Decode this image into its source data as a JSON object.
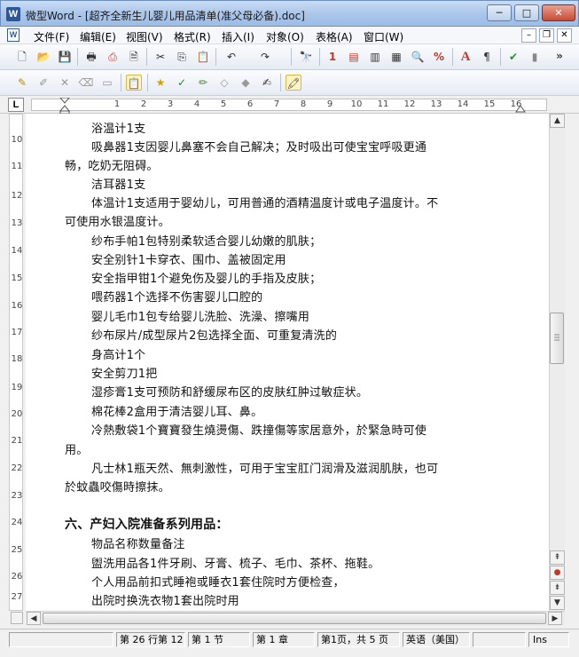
{
  "window": {
    "app_name": "微型Word",
    "title": "- [超齐全新生儿婴儿用品清单(准父母必备).doc]",
    "minimize": "─",
    "maximize": "□",
    "close": "✕"
  },
  "menu": {
    "items": [
      "文件(F)",
      "编辑(E)",
      "视图(V)",
      "格式(R)",
      "插入(I)",
      "对象(O)",
      "表格(A)",
      "窗口(W)"
    ],
    "mdi_minimize": "–",
    "mdi_restore": "❐",
    "mdi_close": "✕"
  },
  "toolbar1": {
    "icons": [
      "new-icon",
      "open-icon",
      "save-icon",
      "print-icon",
      "pdf-icon",
      "print-preview-icon",
      "cut-icon",
      "copy-icon",
      "paste-icon",
      "undo-icon",
      "redo-icon",
      "find-icon",
      "page-number-icon",
      "header-icon",
      "footer-icon",
      "columns-icon",
      "zoom-icon",
      "percent-icon",
      "font-icon",
      "paragraph-icon",
      "spellcheck-icon",
      "word-count-icon"
    ],
    "glyphs": [
      "🗋",
      "📂",
      "💾",
      "🖶",
      "⎙",
      "🗎",
      "✂",
      "⎘",
      "📋",
      "↶",
      "↷",
      "🔭",
      "1",
      "▤",
      "▥",
      "▦",
      "🔍",
      "%",
      "A",
      "¶",
      "✔",
      "▮"
    ],
    "overflow": "»"
  },
  "toolbar2": {
    "icons": [
      "highlight-icon",
      "edit-icon",
      "delete-icon",
      "clear-icon",
      "erase-icon",
      "clipboard-icon",
      "star-icon",
      "check-icon",
      "pencil-icon",
      "eraser-icon",
      "eraser2-icon",
      "note-icon",
      "highlighter-icon"
    ],
    "glyphs": [
      "✎",
      "✐",
      "✕",
      "⌫",
      "▭",
      "📋",
      "★",
      "✓",
      "✏",
      "◇",
      "◆",
      "✍",
      "🖍"
    ]
  },
  "ruler": {
    "corner": "L",
    "numbers": [
      "1",
      "2",
      "3",
      "4",
      "5",
      "6",
      "7",
      "8",
      "9",
      "10",
      "11",
      "12",
      "13",
      "14",
      "15",
      "16"
    ]
  },
  "vruler": {
    "numbers": [
      "10",
      "11",
      "12",
      "13",
      "14",
      "15",
      "16",
      "17",
      "18",
      "19",
      "20",
      "21",
      "22",
      "23",
      "24",
      "25",
      "26",
      "27"
    ]
  },
  "document": {
    "lines": [
      "浴温计1支",
      "吸鼻器1支因婴儿鼻塞不会自己解决；及时吸出可使宝宝呼吸更通",
      "畅，吃奶无阻碍。",
      "洁耳器1支",
      "体温计1支适用于婴幼儿，可用普通的酒精温度计或电子温度计。不",
      "可使用水银温度计。",
      "纱布手帕1包特别柔软适合婴儿幼嫩的肌肤；",
      "安全别针1卡穿衣、围巾、盖被固定用",
      "安全指甲钳1个避免伤及婴儿的手指及皮肤；",
      "喂药器1个选择不伤害婴儿口腔的",
      "婴儿毛巾1包专给婴儿洗脸、洗澡、擦嘴用",
      "纱布尿片/成型尿片2包选择全面、可重复清洗的",
      "身高计1个",
      "安全剪刀1把",
      "湿疹膏1支可预防和舒缓尿布区的皮肤红肿过敏症状。",
      "棉花棒2盒用于清洁婴儿耳、鼻。",
      "冷熱敷袋1个寶寶發生燒燙傷、跌撞傷等家居意外，於緊急時可使",
      "用。",
      "凡士林1瓶天然、無刺激性，可用于宝宝肛门润滑及滋润肌肤，也可",
      "於蚊蟲咬傷時擦抹。",
      "",
      "六、产妇入院准备系列用品：",
      "物品名称数量备注",
      "盥洗用品各1件牙刷、牙膏、梳子、毛巾、茶杯、拖鞋。",
      "个人用品前扣式睡袍或睡衣1套住院时方便检查，",
      "出院时换洗衣物1套出院时用"
    ]
  },
  "status": {
    "position": "第 26 行第 12",
    "section": "第 1 节",
    "chapter": "第 1 章",
    "page": "第1页，共 5 页",
    "language": "英语（美国）",
    "mode": "Ins"
  }
}
